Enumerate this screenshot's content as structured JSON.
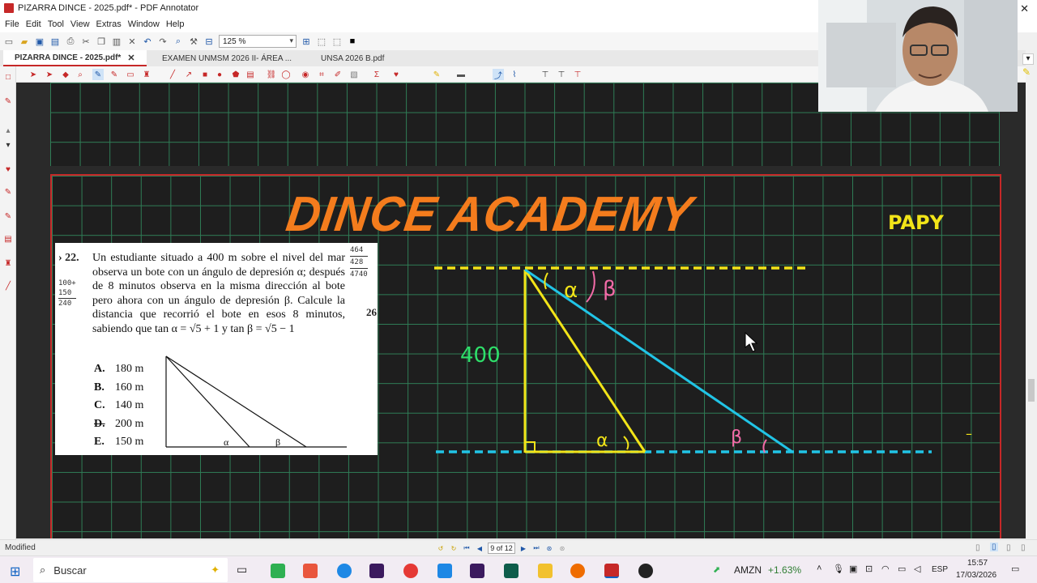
{
  "window": {
    "title": "PIZARRA DINCE - 2025.pdf* - PDF Annotator"
  },
  "menu": [
    "File",
    "Edit",
    "Tool",
    "View",
    "Extras",
    "Window",
    "Help"
  ],
  "toolbar": {
    "zoom": "125 %"
  },
  "tabs": [
    {
      "label": "PIZARRA DINCE - 2025.pdf*",
      "close": "✕"
    },
    {
      "label": "EXAMEN UNMSM 2026 II- ÁREA ..."
    },
    {
      "label": "UNSA 2026 B.pdf"
    }
  ],
  "page": {
    "logo": "DINCE ACADEMY",
    "corner_label": "PAPY",
    "problem": {
      "number": "22.",
      "statement": "Un estudiante situado a 400 m sobre el nivel del mar observa un bote con un ángulo de depresión α; después de 8 minutos observa en la misma dirección al bote pero ahora con un ángulo de depresión β. Calcule la distancia que recorrió el bote en esos 8 minutos, sabiendo que tan α = √5 + 1 y tan β = √5 − 1",
      "options": [
        {
          "letter": "A.",
          "value": "180 m"
        },
        {
          "letter": "B.",
          "value": "160 m"
        },
        {
          "letter": "C.",
          "value": "140 m"
        },
        {
          "letter": "D.",
          "value": "200 m"
        },
        {
          "letter": "E.",
          "value": "150 m"
        }
      ],
      "page_num": "26",
      "scribble_left": [
        "100+",
        "150",
        "240"
      ],
      "scribble_right": [
        "464",
        "428",
        "4740"
      ]
    },
    "annotations": {
      "height_label": "400",
      "alpha": "α",
      "beta": "β",
      "small_dash": "–"
    },
    "colors": {
      "accent_orange": "#f47c1d",
      "chalk_yellow": "#f2e418",
      "chalk_cyan": "#21c4e6",
      "chalk_green": "#2ee06a",
      "chalk_pink": "#f26ba7",
      "grid_green": "#2f7d56",
      "frame_red": "#c62828"
    }
  },
  "status": {
    "left": "Modified",
    "page_indicator": "9 of 12"
  },
  "taskbar": {
    "search_placeholder": "Buscar",
    "stock_symbol": "AMZN",
    "stock_change": "+1.63%",
    "language": "ESP",
    "time": "15:57",
    "date": "17/03/2026"
  }
}
